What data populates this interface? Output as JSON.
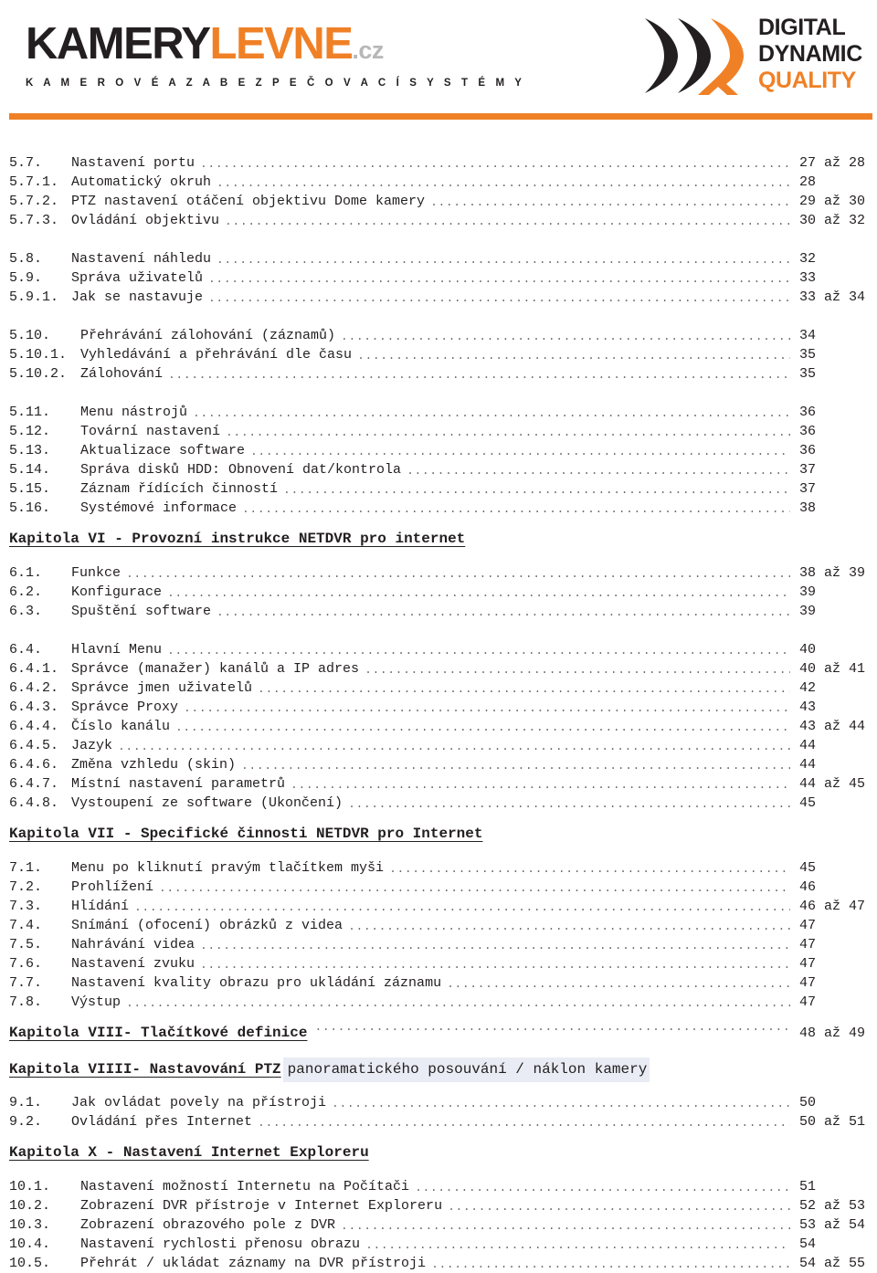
{
  "header": {
    "brand_left": {
      "word_part1": "KAMERY",
      "word_part2": "LEVNE",
      "word_suffix": ".cz",
      "tagline": "K A M E R O V É   A   Z A B E Z P E Č O V A C Í   S Y S T É M Y"
    },
    "brand_right": {
      "line1": "DIGITAL",
      "line2": "DYNAMIC",
      "line3": "QUALITY"
    },
    "colors": {
      "orange": "#f08026",
      "dark": "#231f20",
      "grey": "#b7b7b7",
      "highlight": "#e9ecf4"
    }
  },
  "toc": {
    "groups": [
      {
        "type": "entries",
        "items": [
          {
            "num": "5.7.",
            "title": "Nastavení portu",
            "pages": "27 až 28"
          },
          {
            "num": "5.7.1.",
            "title": "Automatický okruh",
            "pages": "28"
          },
          {
            "num": "5.7.2.",
            "title": "PTZ nastavení otáčení objektivu Dome kamery",
            "pages": "29 až 30"
          },
          {
            "num": "5.7.3.",
            "title": "Ovládání objektivu",
            "pages": "30 až 32"
          }
        ]
      },
      {
        "type": "entries",
        "items": [
          {
            "num": "5.8.",
            "title": "Nastavení náhledu",
            "pages": "32"
          },
          {
            "num": "5.9.",
            "title": "Správa uživatelů",
            "pages": "33"
          },
          {
            "num": "5.9.1.",
            "title": "Jak se nastavuje",
            "pages": "33 až 34"
          }
        ]
      },
      {
        "type": "entries",
        "wide": true,
        "items": [
          {
            "num": "5.10.",
            "title": "Přehrávání zálohování (záznamů)",
            "pages": "34"
          },
          {
            "num": "5.10.1.",
            "title": "Vyhledávání a přehrávání dle času",
            "pages": "35"
          },
          {
            "num": "5.10.2.",
            "title": "Zálohování",
            "pages": "35"
          }
        ]
      },
      {
        "type": "entries",
        "wide": true,
        "items": [
          {
            "num": "5.11.",
            "title": "Menu nástrojů",
            "pages": "36"
          },
          {
            "num": "5.12.",
            "title": "Tovární nastavení",
            "pages": "36"
          },
          {
            "num": "5.13.",
            "title": "Aktualizace software",
            "pages": "36"
          },
          {
            "num": "5.14.",
            "title": "Správa disků HDD: Obnovení dat/kontrola",
            "pages": "37"
          },
          {
            "num": "5.15.",
            "title": "Záznam řídících činností",
            "pages": "37"
          },
          {
            "num": "5.16.",
            "title": "Systémové informace",
            "pages": "38"
          }
        ]
      },
      {
        "type": "chapter",
        "heading": "Kapitola VI - Provozní instrukce NETDVR pro internet",
        "sub": "",
        "pages": "",
        "dots": false
      },
      {
        "type": "entries",
        "items": [
          {
            "num": "6.1.",
            "title": "Funkce",
            "pages": "38 až 39"
          },
          {
            "num": "6.2.",
            "title": "Konfigurace",
            "pages": "39"
          },
          {
            "num": "6.3.",
            "title": "Spuštění software",
            "pages": "39"
          }
        ]
      },
      {
        "type": "entries",
        "items": [
          {
            "num": "6.4.",
            "title": "Hlavní Menu",
            "pages": "40"
          },
          {
            "num": "6.4.1.",
            "title": "Správce (manažer) kanálů a IP adres",
            "pages": "40 až 41"
          },
          {
            "num": "6.4.2.",
            "title": "Správce jmen uživatelů",
            "pages": "42"
          },
          {
            "num": "6.4.3.",
            "title": "Správce Proxy",
            "pages": "43"
          },
          {
            "num": "6.4.4.",
            "title": "Číslo kanálu",
            "pages": "43 až 44"
          },
          {
            "num": "6.4.5.",
            "title": "Jazyk",
            "pages": "44"
          },
          {
            "num": "6.4.6.",
            "title": "Změna vzhledu (skin)",
            "pages": "44"
          },
          {
            "num": "6.4.7.",
            "title": "Místní nastavení parametrů",
            "pages": "44 až 45"
          },
          {
            "num": "6.4.8.",
            "title": "Vystoupení ze software (Ukončení)",
            "pages": "45"
          }
        ]
      },
      {
        "type": "chapter",
        "heading": "Kapitola VII - Specifické činnosti NETDVR pro Internet",
        "sub": "",
        "pages": "",
        "dots": false
      },
      {
        "type": "entries",
        "items": [
          {
            "num": "7.1.",
            "title": "Menu po kliknutí pravým tlačítkem myši",
            "pages": "45"
          },
          {
            "num": "7.2.",
            "title": "Prohlížení",
            "pages": "46"
          },
          {
            "num": "7.3.",
            "title": "Hlídání",
            "pages": "46 až 47"
          },
          {
            "num": "7.4.",
            "title": "Snímání (ofocení) obrázků z videa",
            "pages": "47"
          },
          {
            "num": "7.5.",
            "title": "Nahrávání videa",
            "pages": "47"
          },
          {
            "num": "7.6.",
            "title": "Nastavení zvuku",
            "pages": "47"
          },
          {
            "num": "7.7.",
            "title": "Nastavení kvality obrazu pro ukládání záznamu",
            "pages": "47"
          },
          {
            "num": "7.8.",
            "title": "Výstup",
            "pages": "47"
          }
        ]
      },
      {
        "type": "chapter",
        "heading": "Kapitola VIII- Tlačítkové definice",
        "sub": "",
        "pages": "48 až 49",
        "dots": true
      },
      {
        "type": "chapter",
        "heading": "Kapitola VIIII- Nastavování PTZ",
        "sub": "panoramatického posouvání / náklon kamery",
        "pages": "",
        "dots": false
      },
      {
        "type": "entries",
        "items": [
          {
            "num": "9.1.",
            "title": "Jak ovládat povely na přístroji",
            "pages": "50"
          },
          {
            "num": "9.2.",
            "title": "Ovládání přes Internet",
            "pages": "50 až 51"
          }
        ]
      },
      {
        "type": "chapter",
        "heading": "Kapitola X - Nastavení Internet Exploreru",
        "sub": "",
        "pages": "",
        "dots": false
      },
      {
        "type": "entries",
        "wide": true,
        "items": [
          {
            "num": "10.1.",
            "title": "Nastavení možností Internetu na Počítači",
            "pages": "51"
          },
          {
            "num": "10.2.",
            "title": "Zobrazení DVR přístroje v Internet Exploreru",
            "pages": "52 až 53"
          },
          {
            "num": "10.3.",
            "title": "Zobrazení obrazového pole z DVR",
            "pages": "53 až 54"
          },
          {
            "num": "10.4.",
            "title": "Nastavení rychlosti přenosu obrazu",
            "pages": "54"
          },
          {
            "num": "10.5.",
            "title": "Přehrát / ukládat záznamy na DVR přístroji",
            "pages": "54 až 55"
          }
        ]
      }
    ]
  }
}
